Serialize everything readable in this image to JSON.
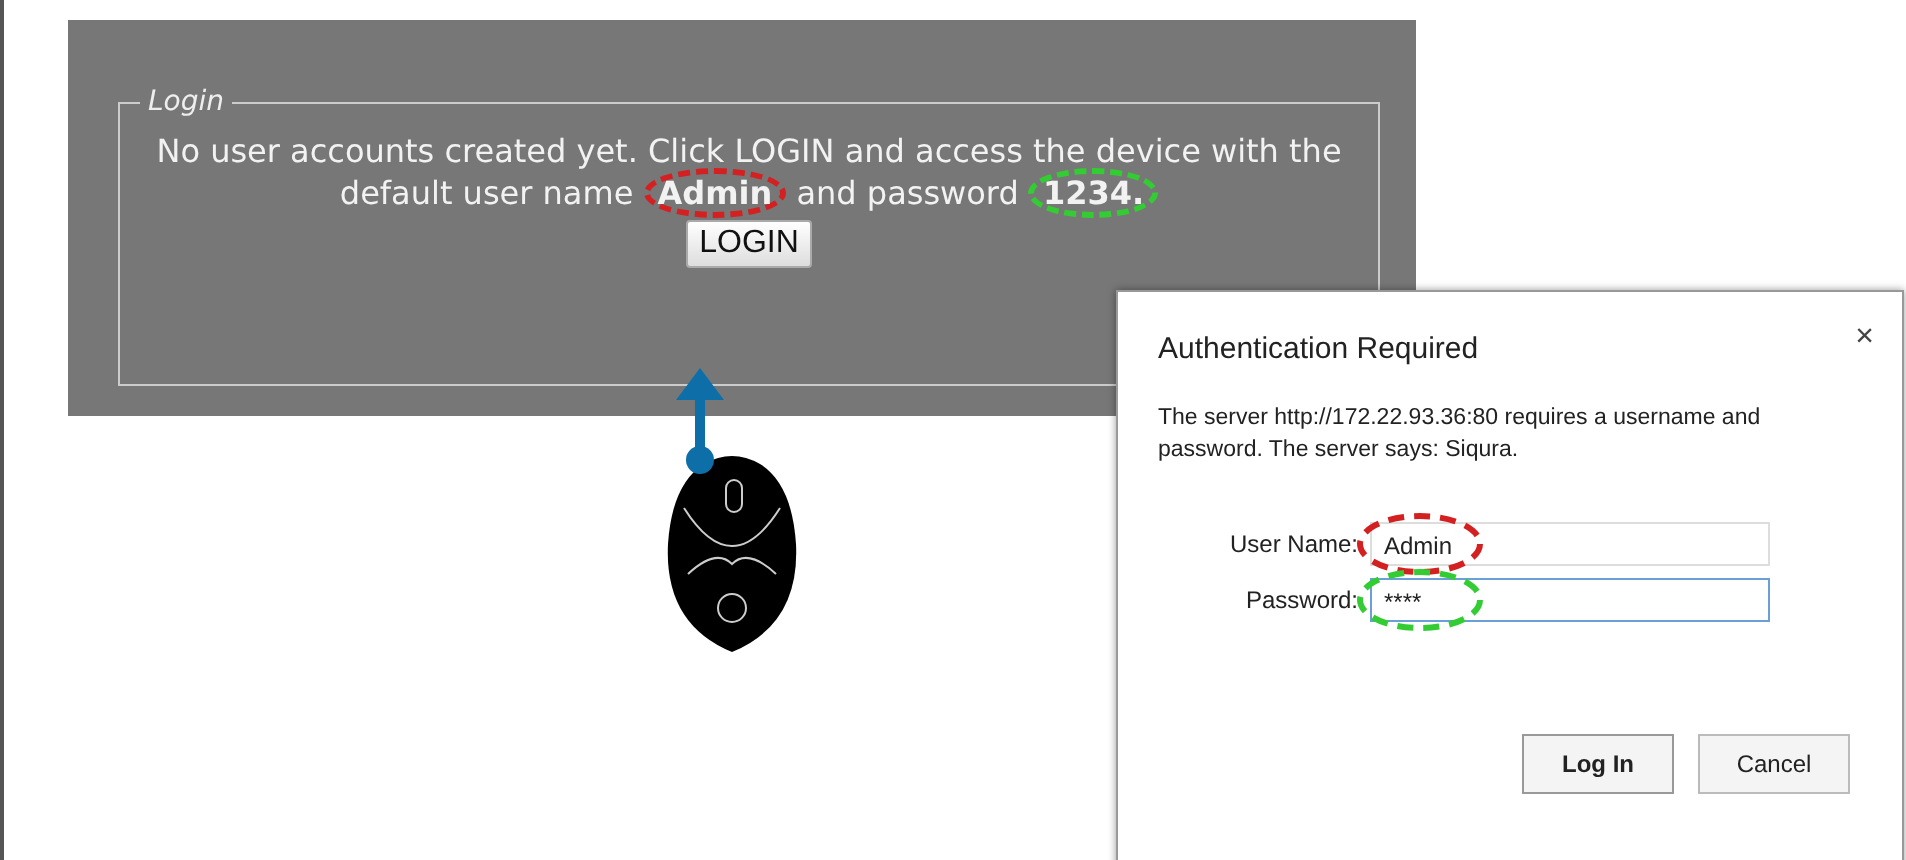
{
  "panel": {
    "legend": "Login",
    "message": "No user accounts created yet. Click LOGIN and access the device with the default user name **Admin** and password **1234.**",
    "button": "LOGIN"
  },
  "dialog": {
    "title": "Authentication Required",
    "close": "×",
    "message": "The server http://172.22.93.36:80 requires a username and password. The server says: Siqura.",
    "fields": [
      {
        "label": "User Name:",
        "value": "Admin",
        "focused": false,
        "color": "#d42020"
      },
      {
        "label": "Password:",
        "value": "****",
        "focused": true,
        "color": "#33cc33"
      }
    ],
    "buttons": [
      {
        "label": "Log In",
        "default": true
      },
      {
        "label": "Cancel",
        "default": false
      }
    ]
  }
}
